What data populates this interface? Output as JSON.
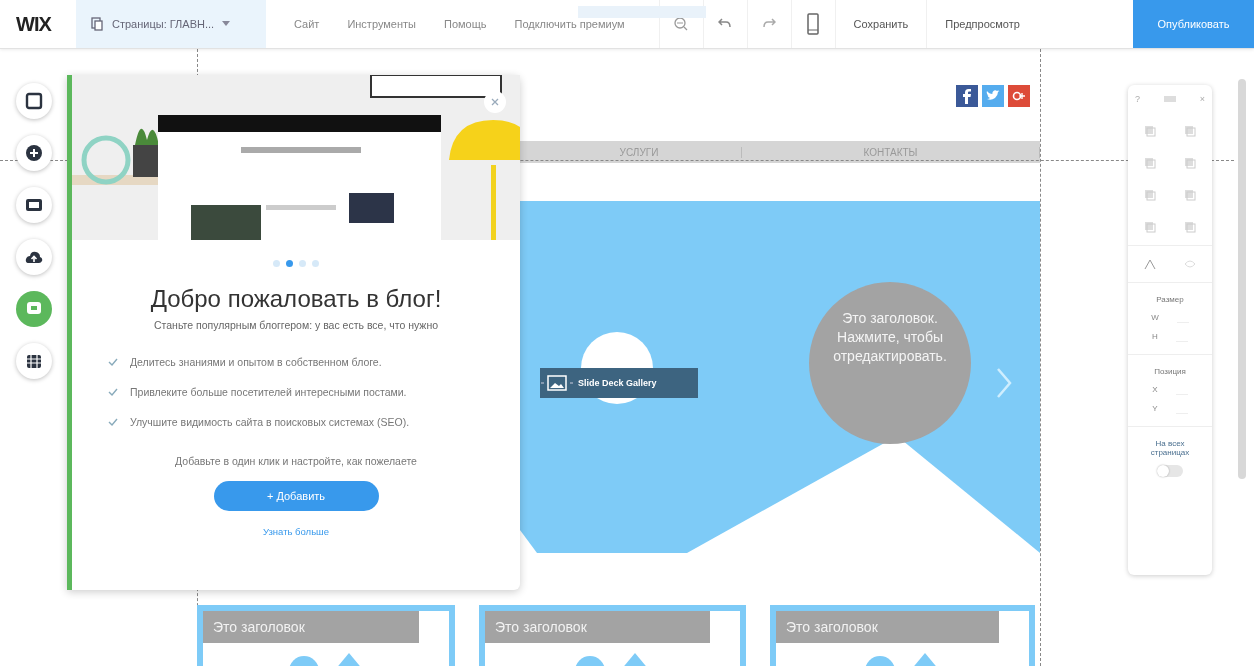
{
  "topbar": {
    "logo": "WIX",
    "pages": "Страницы: ГЛАВН...",
    "menu": [
      "Сайт",
      "Инструменты",
      "Помощь",
      "Подключить премиум"
    ],
    "save": "Сохранить",
    "preview": "Предпросмотр",
    "publish": "Опубликовать"
  },
  "left_tools": [
    {
      "kind": "page",
      "selected": false
    },
    {
      "kind": "add",
      "selected": false
    },
    {
      "kind": "background",
      "selected": false
    },
    {
      "kind": "upload",
      "selected": false
    },
    {
      "kind": "blog",
      "selected": true
    },
    {
      "kind": "apps",
      "selected": false
    }
  ],
  "blog_panel": {
    "dots": [
      {
        "selected": false
      },
      {
        "selected": true
      },
      {
        "selected": false
      },
      {
        "selected": false
      }
    ],
    "title": "Добро пожаловать в блог!",
    "subtitle": "Станьте популярным блоггером: у вас есть все, что нужно",
    "features": [
      "Делитесь знаниями и опытом в собственном блоге.",
      "Привлеките больше посетителей интересными постами.",
      "Улучшите видимость сайта в поисковых системах (SEO)."
    ],
    "note": "Добавьте в один клик и настройте, как пожелаете",
    "add_button": "+ Добавить",
    "link": "Узнать больше"
  },
  "site": {
    "nav": [
      "УСЛУГИ",
      "КОНТАКТЫ"
    ],
    "gallery_label": "Slide Deck Gallery",
    "hero_heading": "Это заголовок. Нажмите, чтобы отредактировать.",
    "cards": [
      "Это заголовок",
      "Это заголовок",
      "Это заголовок"
    ]
  },
  "inspector": {
    "help": "?",
    "close": "×",
    "size_label": "Размер",
    "size_fields": [
      "W",
      "H"
    ],
    "position_label": "Позиция",
    "position_fields": [
      "X",
      "Y"
    ],
    "all_pages_label": "На всех страницах",
    "all_pages_on": false
  }
}
